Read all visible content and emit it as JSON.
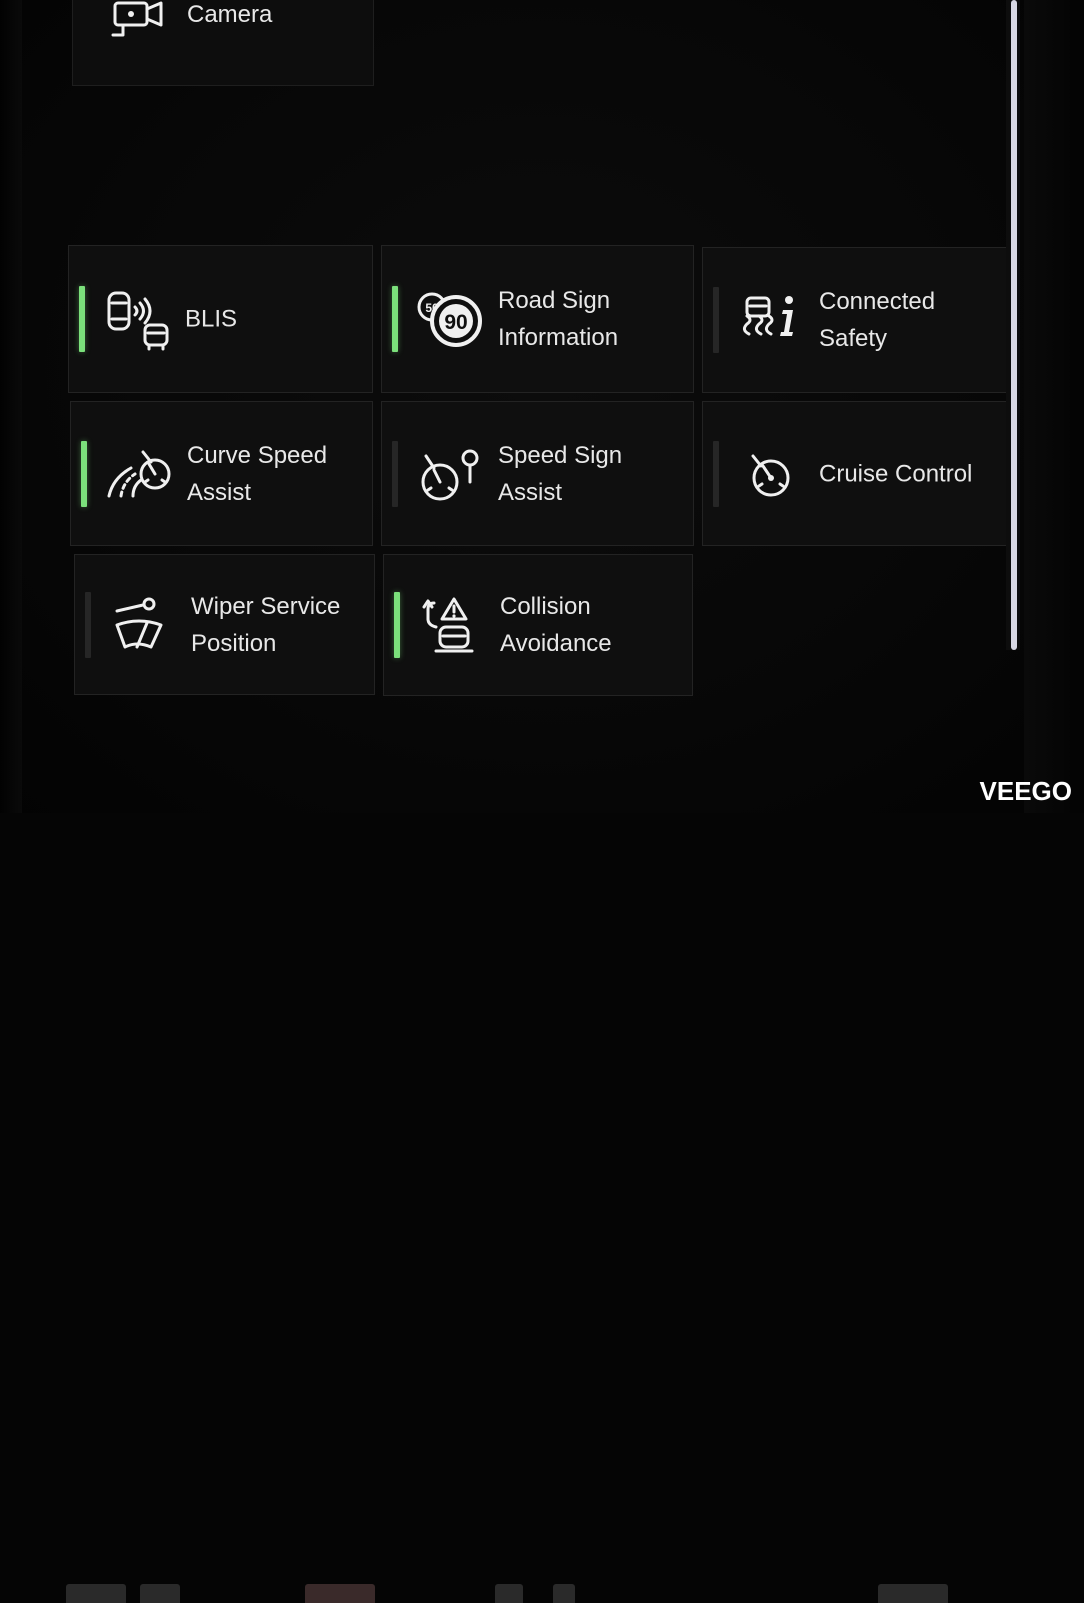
{
  "camera_tile": {
    "label": "Camera",
    "icon": "camera-icon"
  },
  "tiles": [
    {
      "id": "blis",
      "label": "BLIS",
      "active": true,
      "icon": "blind-spot-icon"
    },
    {
      "id": "road-sign-information",
      "label": "Road Sign\nInformation",
      "active": true,
      "icon": "speed-limit-sign-icon",
      "icon_text_small": "50",
      "icon_text_large": "90"
    },
    {
      "id": "connected-safety",
      "label": "Connected\nSafety",
      "active": false,
      "icon": "connected-safety-icon"
    },
    {
      "id": "curve-speed-assist",
      "label": "Curve Speed\nAssist",
      "active": true,
      "icon": "curve-speed-icon"
    },
    {
      "id": "speed-sign-assist",
      "label": "Speed Sign\nAssist",
      "active": false,
      "icon": "speed-sign-assist-icon"
    },
    {
      "id": "cruise-control",
      "label": "Cruise Control",
      "active": false,
      "icon": "cruise-control-icon"
    },
    {
      "id": "wiper-service-position",
      "label": "Wiper Service\nPosition",
      "active": false,
      "icon": "wiper-wrench-icon"
    },
    {
      "id": "collision-avoidance",
      "label": "Collision\nAvoidance",
      "active": true,
      "icon": "collision-warning-icon"
    }
  ],
  "colors": {
    "active_indicator": "#7be07b",
    "inactive_indicator": "#262626",
    "tile_bg": "#0f0f0f"
  },
  "watermark": "VEEGO"
}
